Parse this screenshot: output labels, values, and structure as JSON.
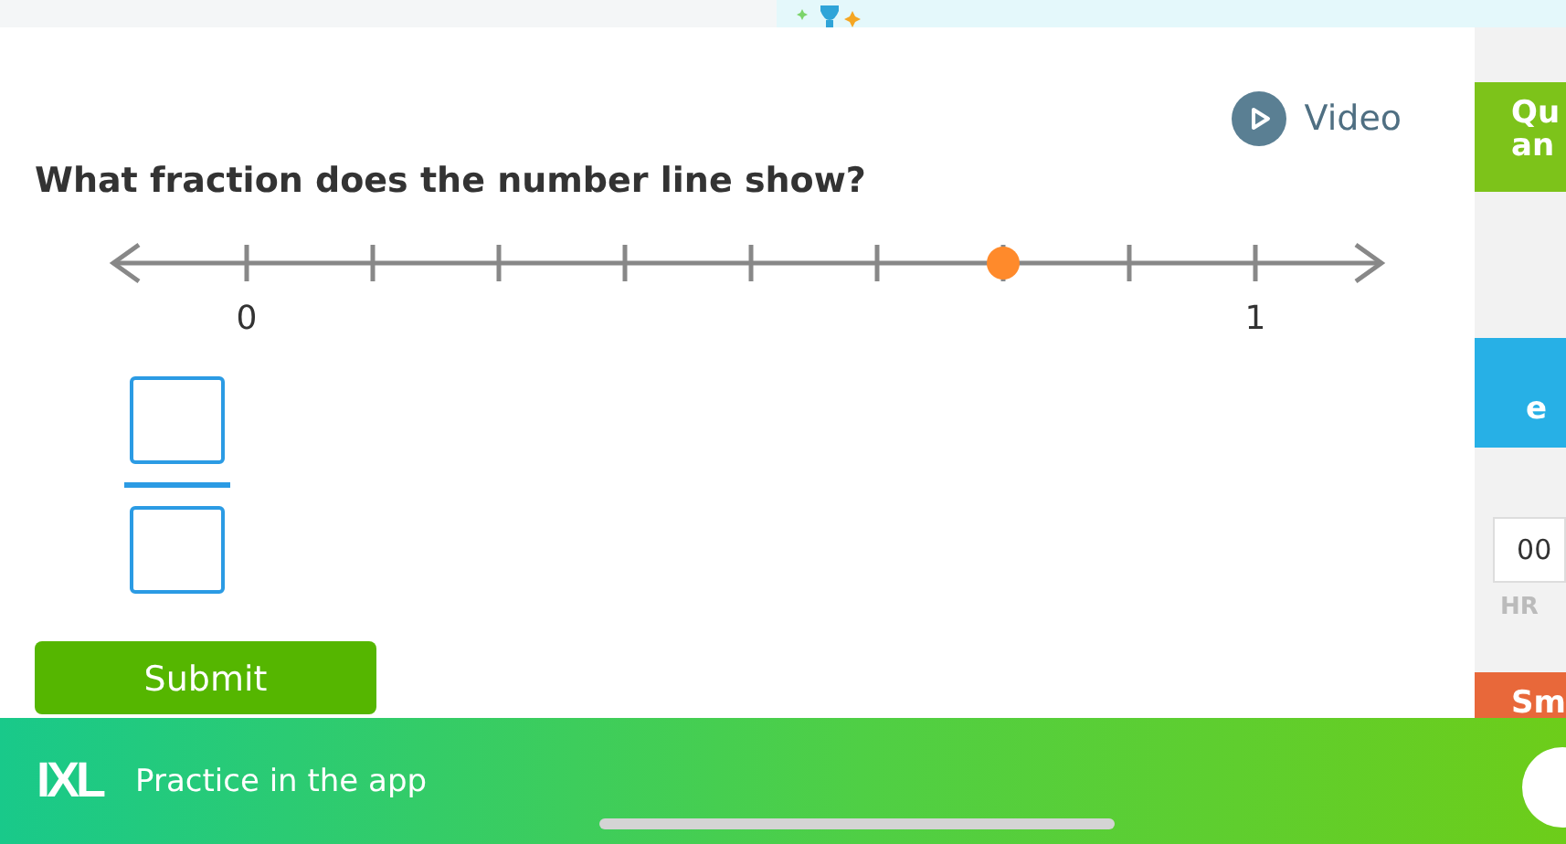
{
  "video": {
    "label": "Video"
  },
  "question": "What fraction does the number line show?",
  "number_line": {
    "ticks": [
      {
        "kind": "labeled",
        "label": "0"
      },
      {
        "kind": "plain"
      },
      {
        "kind": "plain"
      },
      {
        "kind": "plain"
      },
      {
        "kind": "plain"
      },
      {
        "kind": "plain"
      },
      {
        "kind": "point"
      },
      {
        "kind": "plain"
      },
      {
        "kind": "labeled",
        "label": "1"
      }
    ]
  },
  "submit": "Submit",
  "sidebar": {
    "cards": [
      {
        "kind": "green",
        "lines": [
          "Qu",
          "an"
        ]
      },
      {
        "kind": "blue",
        "lines": [
          "e"
        ]
      },
      {
        "kind": "timer",
        "value": "00",
        "unit": "HR"
      },
      {
        "kind": "orange",
        "lines": [
          "Sm"
        ]
      }
    ]
  },
  "app_banner": {
    "logo": "IXL",
    "text": "Practice in the app"
  }
}
